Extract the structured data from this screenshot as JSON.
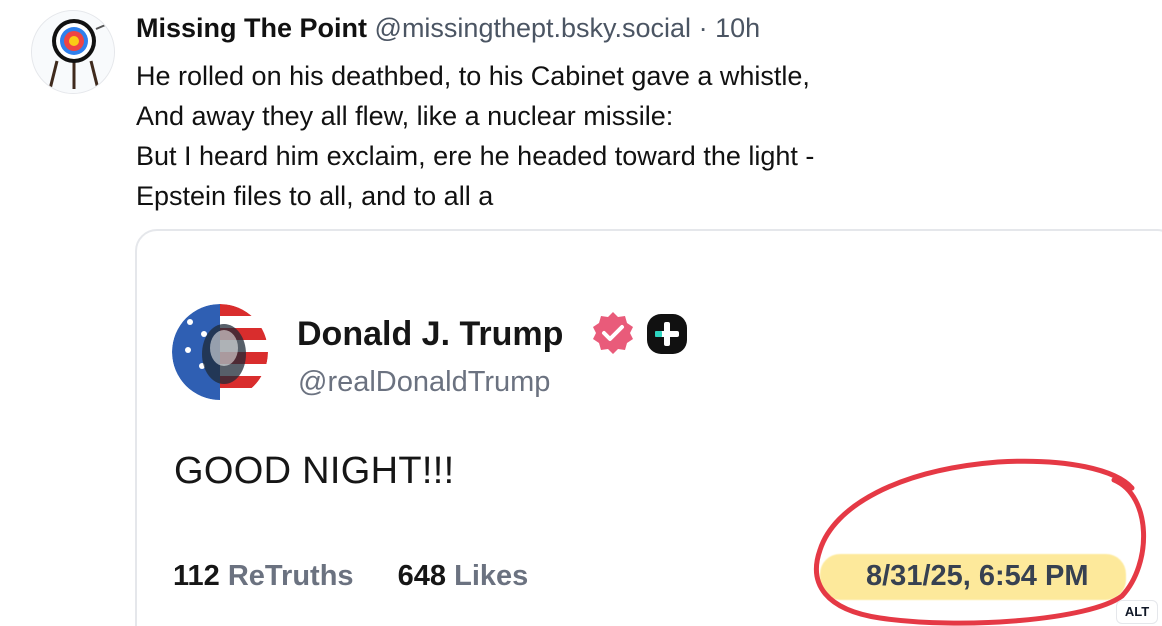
{
  "colors": {
    "annotation_circle": "#e53945",
    "highlight": "#fde68a",
    "verified_badge": "#e95b7a",
    "plus_badge": "#111111",
    "plus_badge_accent": "#2dd4bf"
  },
  "post": {
    "author_name": "Missing The Point",
    "handle": "@missingthept.bsky.social",
    "separator": "·",
    "time_ago": "10h",
    "text_lines": [
      "He rolled on his deathbed, to his Cabinet gave a whistle,",
      "And away they all flew, like a nuclear missile:",
      "But I heard him exclaim, ere he headed toward the light -",
      "Epstein files to all, and to all a"
    ],
    "avatar_icon": "target-archery-icon"
  },
  "embed": {
    "name": "Donald J. Trump",
    "handle": "@realDonaldTrump",
    "verified_icon": "verified-badge-icon",
    "plus_icon": "plus-badge-icon",
    "body": "GOOD NIGHT!!!",
    "retruths_count": "112",
    "retruths_label": "ReTruths",
    "likes_count": "648",
    "likes_label": "Likes",
    "timestamp": "8/31/25, 6:54 PM",
    "alt_label": "ALT"
  }
}
